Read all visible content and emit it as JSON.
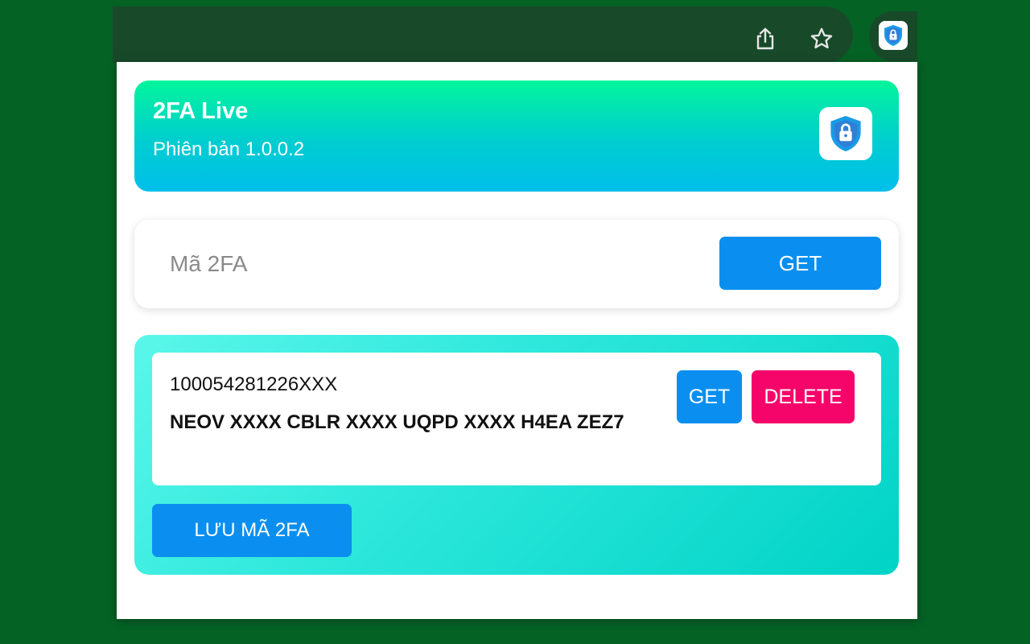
{
  "browser": {
    "share_icon": "share-icon",
    "star_icon": "star-icon",
    "extension_icon": "shield-lock-icon"
  },
  "popup": {
    "header": {
      "title": "2FA Live",
      "version": "Phiên bản 1.0.0.2",
      "logo_icon": "shield-lock-icon"
    },
    "input": {
      "placeholder": "Mã 2FA",
      "value": "",
      "get_label": "GET"
    },
    "entries": [
      {
        "id": "100054281226XXX",
        "secret": "NEOV XXXX CBLR XXXX UQPD XXXX H4EA ZEZ7",
        "get_label": "GET",
        "delete_label": "DELETE"
      }
    ],
    "save_label": "LƯU MÃ 2FA"
  },
  "colors": {
    "page_bg": "#046225",
    "toolbar_bg": "#184a2a",
    "button_blue": "#0a8ff0",
    "button_pink": "#f5056a",
    "header_gradient_top": "#02f59b",
    "header_gradient_bottom": "#00bfeb",
    "list_gradient_start": "#5af7ea",
    "list_gradient_end": "#00d3c6"
  }
}
